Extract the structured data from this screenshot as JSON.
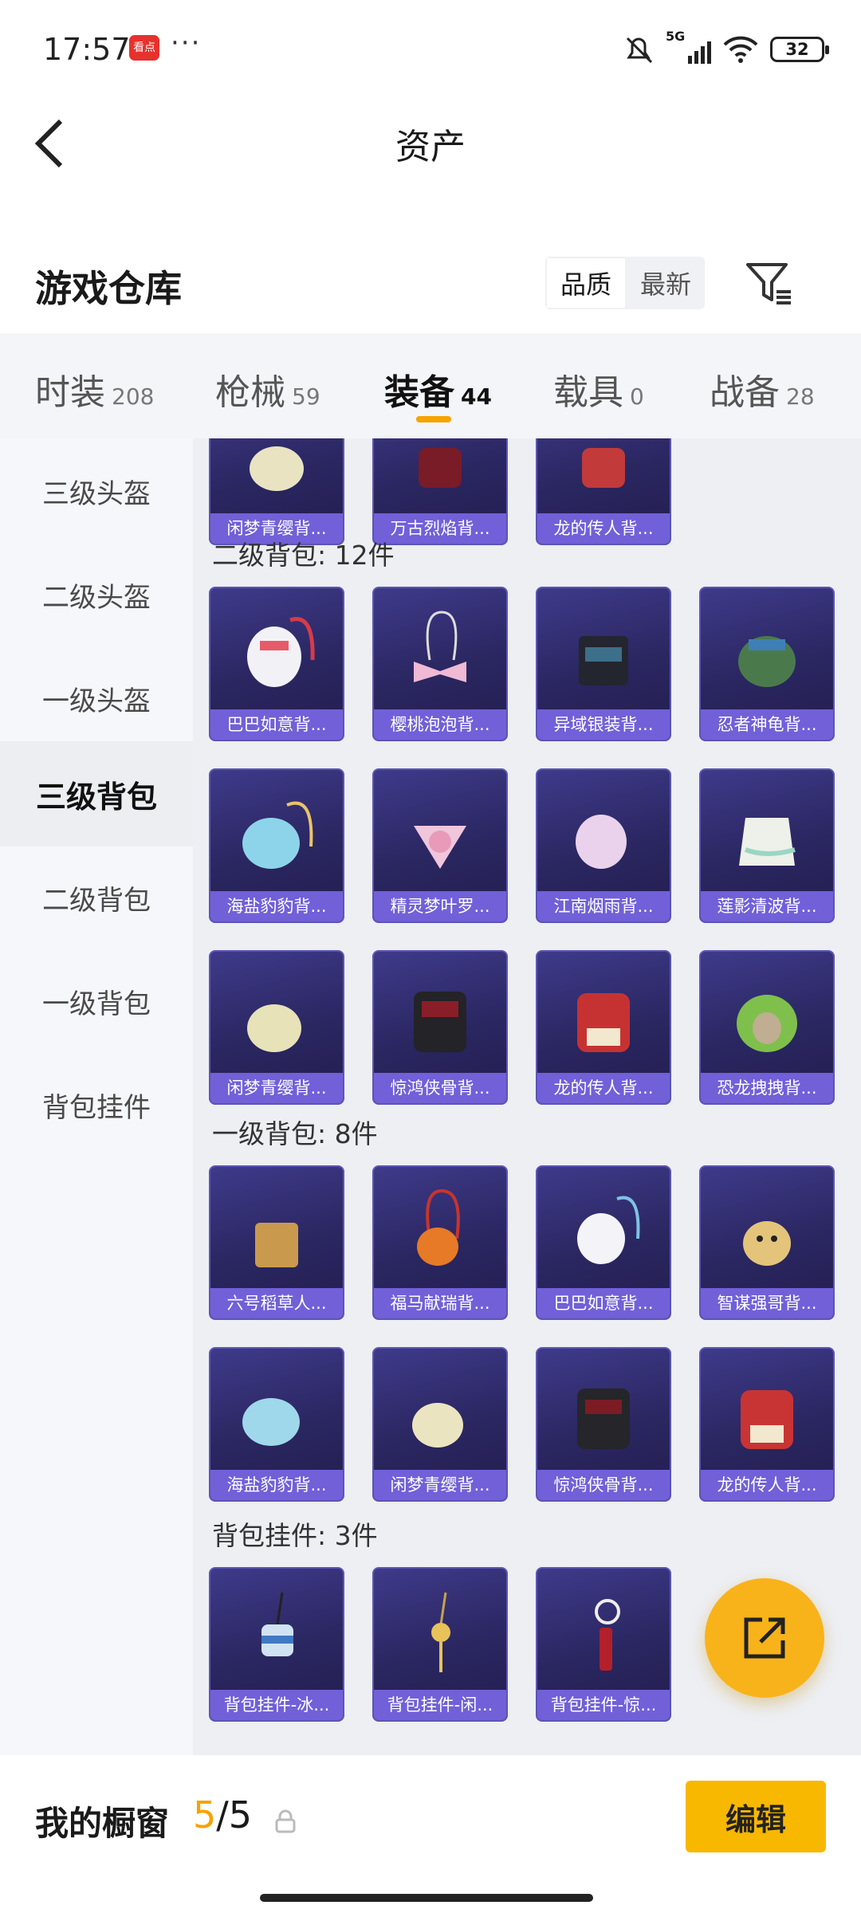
{
  "status": {
    "time": "17:57",
    "app_icon_text": "看点",
    "more": "···",
    "network": "5G",
    "battery": "32"
  },
  "header": {
    "title": "资产"
  },
  "section": {
    "title": "游戏仓库"
  },
  "sort": {
    "quality": "品质",
    "newest": "最新"
  },
  "tabs": [
    {
      "label": "时装",
      "count": "208"
    },
    {
      "label": "枪械",
      "count": "59"
    },
    {
      "label": "装备",
      "count": "44"
    },
    {
      "label": "载具",
      "count": "0"
    },
    {
      "label": "战备",
      "count": "28"
    }
  ],
  "sidebar": [
    "三级头盔",
    "二级头盔",
    "一级头盔",
    "三级背包",
    "二级背包",
    "一级背包",
    "背包挂件"
  ],
  "groups": {
    "partial_row": [
      "闲梦青缨背...",
      "万古烈焰背...",
      "龙的传人背..."
    ],
    "lvl2": {
      "title": "二级背包: 12件",
      "items": [
        "巴巴如意背...",
        "樱桃泡泡背...",
        "异域银装背...",
        "忍者神龟背...",
        "海盐豹豹背...",
        "精灵梦叶罗...",
        "江南烟雨背...",
        "莲影清波背...",
        "闲梦青缨背...",
        "惊鸿侠骨背...",
        "龙的传人背...",
        "恐龙拽拽背..."
      ]
    },
    "lvl1": {
      "title": "一级背包: 8件",
      "items": [
        "六号稻草人...",
        "福马献瑞背...",
        "巴巴如意背...",
        "智谋强哥背...",
        "海盐豹豹背...",
        "闲梦青缨背...",
        "惊鸿侠骨背...",
        "龙的传人背..."
      ]
    },
    "pendant": {
      "title": "背包挂件: 3件",
      "items": [
        "背包挂件-冰...",
        "背包挂件-闲...",
        "背包挂件-惊..."
      ]
    }
  },
  "bottom": {
    "showcase_label": "我的橱窗",
    "current": "5",
    "total": "/5",
    "edit": "编辑"
  },
  "colors": {
    "accent": "#f5a300",
    "card_bg": "#2a2660",
    "card_label": "#7160d8"
  }
}
